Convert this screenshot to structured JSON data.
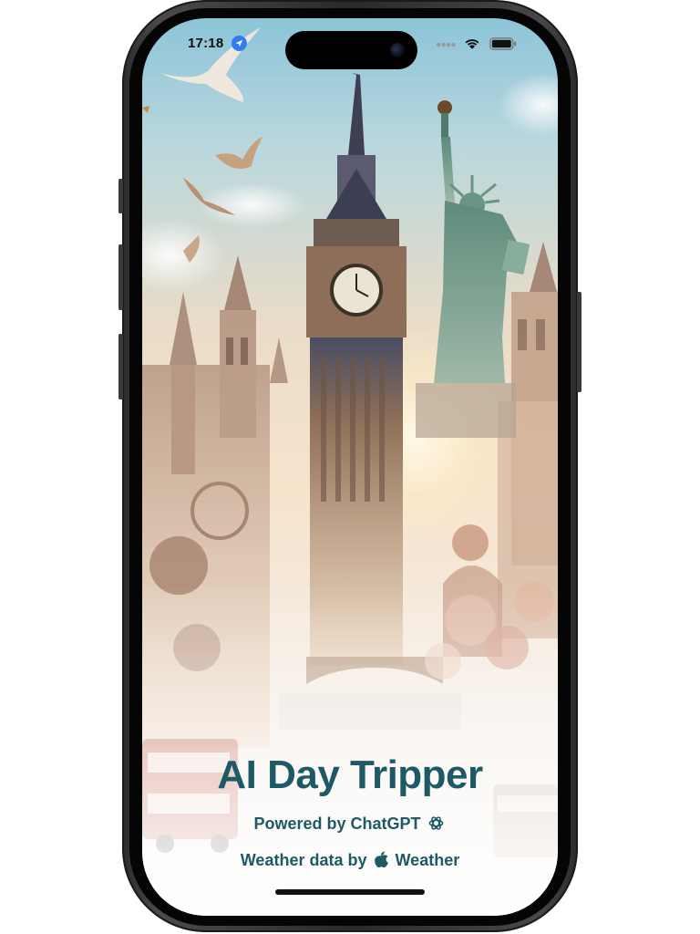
{
  "status_bar": {
    "time": "17:18",
    "location_icon": "location-arrow-icon",
    "signal_icon": "cellular-signal-icon",
    "wifi_icon": "wifi-icon",
    "battery_icon": "battery-icon"
  },
  "splash": {
    "title": "AI Day Tripper",
    "powered_by_label": "Powered by ChatGPT",
    "powered_by_icon": "chatgpt-logo-icon",
    "weather_label": "Weather data by",
    "weather_brand_icon": "apple-logo-icon",
    "weather_brand": "Weather"
  },
  "colors": {
    "title_text": "#1e5a66",
    "location_badge": "#2f7cf6"
  }
}
